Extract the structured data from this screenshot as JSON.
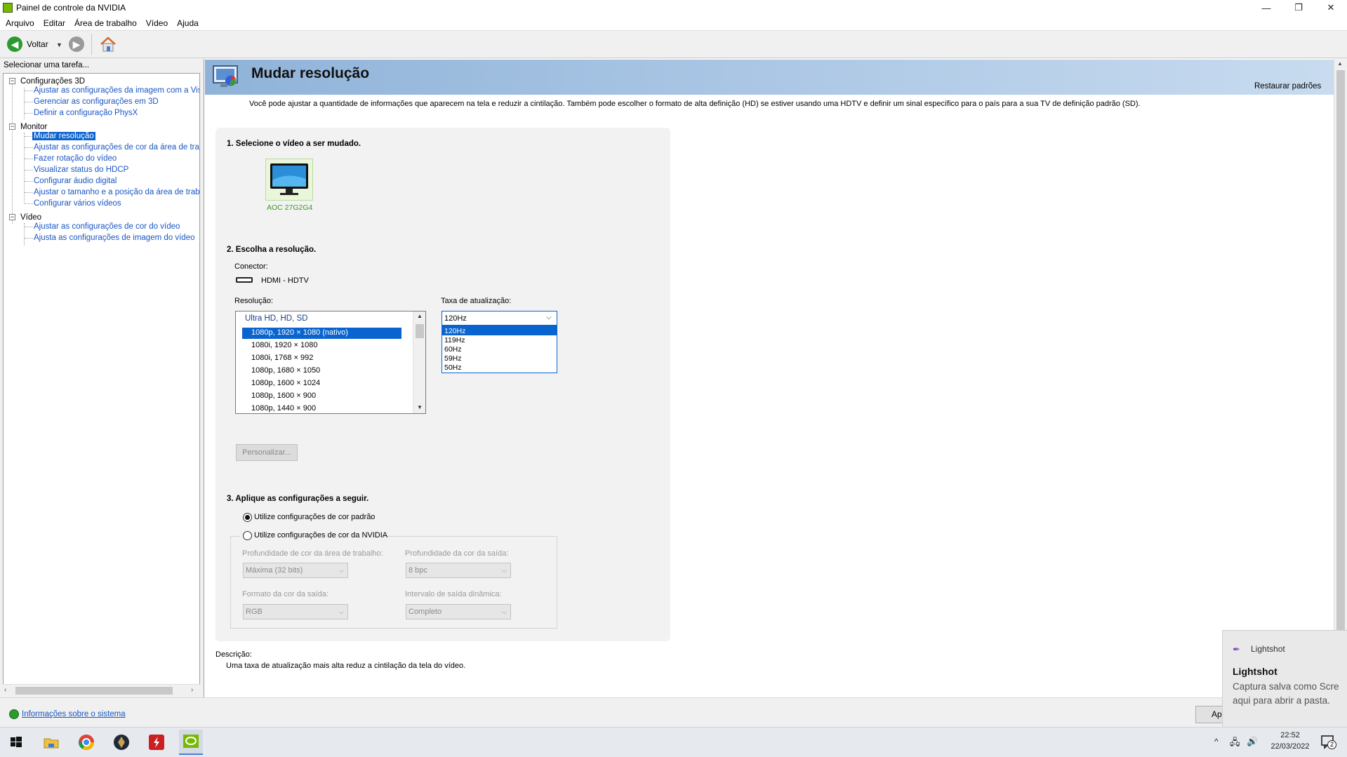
{
  "window": {
    "title": "Painel de controle da NVIDIA",
    "min_glyph": "—",
    "max_glyph": "❐",
    "close_glyph": "✕"
  },
  "menu": [
    "Arquivo",
    "Editar",
    "Área de trabalho",
    "Vídeo",
    "Ajuda"
  ],
  "toolbar": {
    "back_label": "Voltar"
  },
  "sidebar": {
    "heading": "Selecionar uma tarefa...",
    "groups": [
      {
        "label": "Configurações 3D",
        "items": [
          "Ajustar as configurações da imagem com a Visuali",
          "Gerenciar as configurações em 3D",
          "Definir a configuração PhysX"
        ]
      },
      {
        "label": "Monitor",
        "items": [
          "Mudar resolução",
          "Ajustar as configurações de cor da área de trabal",
          "Fazer rotação do vídeo",
          "Visualizar status do HDCP",
          "Configurar áudio digital",
          "Ajustar o tamanho e a posição da área de trabalh",
          "Configurar vários vídeos"
        ]
      },
      {
        "label": "Vídeo",
        "items": [
          "Ajustar as configurações de cor do vídeo",
          "Ajusta as configurações de imagem do vídeo"
        ]
      }
    ],
    "selected_item": "Mudar resolução",
    "expander_glyph": "−",
    "footer_link": "Informações sobre o sistema"
  },
  "page": {
    "title": "Mudar resolução",
    "restore_link": "Restaurar padrões",
    "intro": "Você pode ajustar a quantidade de informações que aparecem na tela e reduzir  a cintilação. Também pode escolher o formato de alta definição (HD) se estiver usando uma HDTV e definir um sinal específico para o país para a sua TV de definição padrão (SD).",
    "section1": {
      "title": "1. Selecione o vídeo a ser mudado.",
      "display_name": "AOC 27G2G4"
    },
    "section2": {
      "title": "2. Escolha a resolução.",
      "connector_label": "Conector:",
      "connector_value": "HDMI - HDTV",
      "resolution_label": "Resolução:",
      "resolution_group": "Ultra HD, HD, SD",
      "resolutions": [
        "1080p, 1920 × 1080 (nativo)",
        "1080i, 1920 × 1080",
        "1080i, 1768 × 992",
        "1080p, 1680 × 1050",
        "1080p, 1600 × 1024",
        "1080p, 1600 × 900",
        "1080p, 1440 × 900"
      ],
      "selected_resolution": "1080p, 1920 × 1080 (nativo)",
      "refresh_label": "Taxa de atualização:",
      "refresh_value": "120Hz",
      "refresh_options": [
        "120Hz",
        "119Hz",
        "60Hz",
        "59Hz",
        "50Hz"
      ],
      "customize_button": "Personalizar..."
    },
    "section3": {
      "title": "3. Aplique as configurações a seguir.",
      "radio_default": "Utilize configurações de cor padrão",
      "radio_nvidia": "Utilize configurações de cor da NVIDIA",
      "desktop_depth_label": "Profundidade de cor da área de trabalho:",
      "desktop_depth_value": "Máxima (32 bits)",
      "output_depth_label": "Profundidade da cor da saída:",
      "output_depth_value": "8 bpc",
      "output_format_label": "Formato da cor da saída:",
      "output_format_value": "RGB",
      "dynamic_range_label": "Intervalo de saída dinâmica:",
      "dynamic_range_value": "Completo"
    },
    "description": {
      "label": "Descrição:",
      "text": "Uma taxa de atualização mais alta reduz a cintilação da tela do vídeo."
    },
    "apply_button": "Ap"
  },
  "toast": {
    "app": "Lightshot",
    "title": "Lightshot",
    "line1": "Captura salva como Scre",
    "line2": "aqui para abrir a pasta."
  },
  "taskbar": {
    "time": "22:52",
    "date": "22/03/2022",
    "notification_count": "2",
    "icons": [
      "windows-start-icon",
      "file-explorer-icon",
      "chrome-icon",
      "game-launcher-icon",
      "flash-app-icon",
      "nvidia-icon"
    ]
  },
  "colors": {
    "link": "#1a56c4",
    "selection": "#0a64cf",
    "nvidia_green": "#76b900",
    "banner": "#a9c5e4"
  }
}
